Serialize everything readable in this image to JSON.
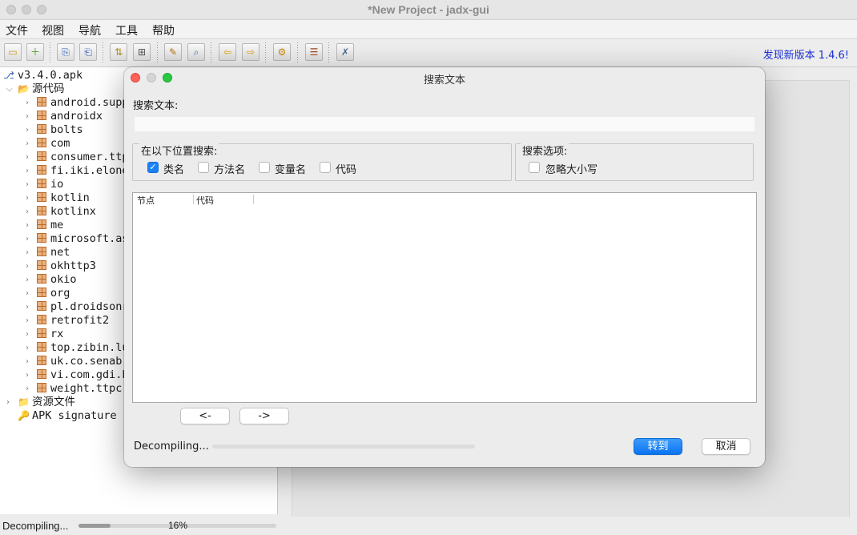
{
  "window": {
    "title": "*New Project - jadx-gui"
  },
  "menubar": {
    "items": [
      "文件",
      "视图",
      "导航",
      "工具",
      "帮助"
    ]
  },
  "toolbar": {
    "update_text": "发现新版本 1.4.6!"
  },
  "tree": {
    "root": "v3.4.0.apk",
    "source_label": "源代码",
    "packages": [
      "android.supp",
      "androidx",
      "bolts",
      "com",
      "consumer.ttp",
      "fi.iki.elone",
      "io",
      "kotlin",
      "kotlinx",
      "me",
      "microsoft.as",
      "net",
      "okhttp3",
      "okio",
      "org",
      "pl.droidsonr",
      "retrofit2",
      "rx",
      "top.zibin.lu",
      "uk.co.senab.",
      "vi.com.gdi.b",
      "weight.ttpc."
    ],
    "resources_label": "资源文件",
    "signature_label": "APK signature"
  },
  "status": {
    "text": "Decompiling...",
    "percent_text": "16%",
    "progress": 0.16
  },
  "dialog": {
    "title": "搜索文本",
    "search_label": "搜索文本:",
    "search_value": "",
    "scope_group": "在以下位置搜索:",
    "scope_options": [
      {
        "label": "类名",
        "checked": true
      },
      {
        "label": "方法名",
        "checked": false
      },
      {
        "label": "变量名",
        "checked": false
      },
      {
        "label": "代码",
        "checked": false
      }
    ],
    "options_group": "搜索选项:",
    "ignore_case": {
      "label": "忽略大小写",
      "checked": false
    },
    "columns": [
      "节点",
      "代码"
    ],
    "prev_label": "<-",
    "next_label": "->",
    "status_text": "Decompiling...",
    "goto_label": "转到",
    "cancel_label": "取消"
  }
}
